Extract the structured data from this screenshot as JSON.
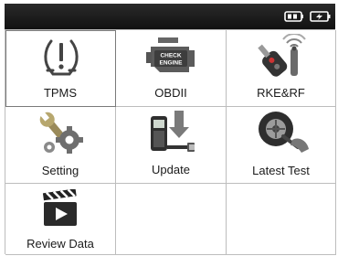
{
  "status_bar": {
    "icons": [
      "battery-icon",
      "power-icon"
    ]
  },
  "menu": {
    "items": [
      {
        "label": "TPMS",
        "icon": "tpms-warning-icon"
      },
      {
        "label": "OBDII",
        "icon": "check-engine-icon"
      },
      {
        "label": "RKE&RF",
        "icon": "key-fob-icon"
      },
      {
        "label": "Setting",
        "icon": "wrench-gear-icon"
      },
      {
        "label": "Update",
        "icon": "update-download-icon"
      },
      {
        "label": "Latest Test",
        "icon": "tire-gauge-icon"
      },
      {
        "label": "Review  Data",
        "icon": "clapperboard-icon"
      }
    ],
    "selected_index": 0
  }
}
